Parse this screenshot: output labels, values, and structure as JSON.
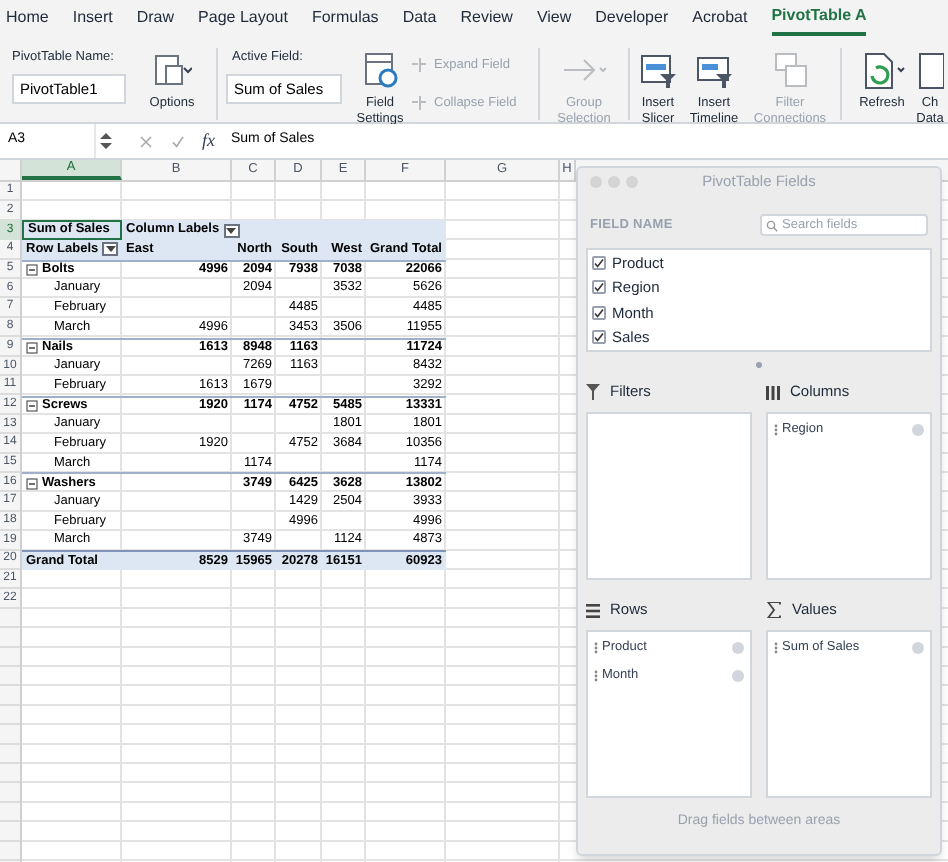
{
  "ribbon_tabs": [
    {
      "label": "Home",
      "selected": false
    },
    {
      "label": "Insert",
      "selected": false
    },
    {
      "label": "Draw",
      "selected": false
    },
    {
      "label": "Page Layout",
      "selected": false
    },
    {
      "label": "Formulas",
      "selected": false
    },
    {
      "label": "Data",
      "selected": false
    },
    {
      "label": "Review",
      "selected": false
    },
    {
      "label": "View",
      "selected": false
    },
    {
      "label": "Developer",
      "selected": false
    },
    {
      "label": "Acrobat",
      "selected": false
    },
    {
      "label": "PivotTable A",
      "selected": true
    }
  ],
  "ribbon": {
    "pivot_name": {
      "label": "PivotTable Name:",
      "value": "PivotTable1"
    },
    "options": {
      "lines": [
        "Options"
      ],
      "disabled": false
    },
    "active_field": {
      "label": "Active Field:",
      "value": "Sum of Sales"
    },
    "field_settings": {
      "lines": [
        "Field",
        "Settings"
      ],
      "disabled": false
    },
    "expand_field": {
      "label": "Expand Field",
      "disabled": true
    },
    "collapse_field": {
      "label": "Collapse Field",
      "disabled": true
    },
    "group_selection": {
      "lines": [
        "Group",
        "Selection"
      ],
      "disabled": true
    },
    "insert_slicer": {
      "lines": [
        "Insert",
        "Slicer"
      ],
      "disabled": false
    },
    "insert_timeline": {
      "lines": [
        "Insert",
        "Timeline"
      ],
      "disabled": false
    },
    "filter_connections": {
      "lines": [
        "Filter",
        "Connections"
      ],
      "disabled": true
    },
    "refresh": {
      "lines": [
        "Refresh"
      ],
      "disabled": false
    },
    "change_data": {
      "lines": [
        "Ch",
        "Data"
      ],
      "disabled": false
    }
  },
  "formula_bar": {
    "cell": "A3",
    "function_label": "fx",
    "formula": "Sum of Sales"
  },
  "columns": [
    {
      "label": "A",
      "selected": true
    },
    {
      "label": "B",
      "selected": false
    },
    {
      "label": "C",
      "selected": false
    },
    {
      "label": "D",
      "selected": false
    },
    {
      "label": "E",
      "selected": false
    },
    {
      "label": "F",
      "selected": false
    },
    {
      "label": "G",
      "selected": false
    },
    {
      "label": "H",
      "selected": false
    }
  ],
  "rows": [
    {
      "number": "1",
      "kind": "empty",
      "selected": false,
      "cells": []
    },
    {
      "number": "2",
      "kind": "empty",
      "selected": false,
      "cells": []
    },
    {
      "number": "3",
      "kind": "header",
      "selected": true,
      "cells": [
        {
          "text": "Sum of Sales"
        },
        {
          "text": "Column Labels",
          "dropdown": true
        }
      ]
    },
    {
      "number": "4",
      "kind": "header",
      "selected": false,
      "cells": [
        {
          "text": "Row Labels",
          "dropdown": true
        },
        "East",
        "North",
        "South",
        "West",
        "Grand Total"
      ]
    },
    {
      "number": "5",
      "kind": "group",
      "expanded": true,
      "selected": false,
      "cells": [
        "Bolts",
        "4996",
        "2094",
        "7938",
        "7038",
        "22066"
      ]
    },
    {
      "number": "6",
      "kind": "item",
      "selected": false,
      "cells": [
        "January",
        null,
        "2094",
        null,
        "3532",
        "5626"
      ]
    },
    {
      "number": "7",
      "kind": "item",
      "selected": false,
      "cells": [
        "February",
        null,
        null,
        "4485",
        null,
        "4485"
      ]
    },
    {
      "number": "8",
      "kind": "item",
      "selected": false,
      "cells": [
        "March",
        "4996",
        null,
        "3453",
        "3506",
        "11955"
      ]
    },
    {
      "number": "9",
      "kind": "group",
      "expanded": true,
      "selected": false,
      "cells": [
        "Nails",
        "1613",
        "8948",
        "1163",
        null,
        "11724"
      ]
    },
    {
      "number": "10",
      "kind": "item",
      "selected": false,
      "cells": [
        "January",
        null,
        "7269",
        "1163",
        null,
        "8432"
      ]
    },
    {
      "number": "11",
      "kind": "item",
      "selected": false,
      "cells": [
        "February",
        "1613",
        "1679",
        null,
        null,
        "3292"
      ]
    },
    {
      "number": "12",
      "kind": "group",
      "expanded": true,
      "selected": false,
      "cells": [
        "Screws",
        "1920",
        "1174",
        "4752",
        "5485",
        "13331"
      ]
    },
    {
      "number": "13",
      "kind": "item",
      "selected": false,
      "cells": [
        "January",
        null,
        null,
        null,
        "1801",
        "1801"
      ]
    },
    {
      "number": "14",
      "kind": "item",
      "selected": false,
      "cells": [
        "February",
        "1920",
        null,
        "4752",
        "3684",
        "10356"
      ]
    },
    {
      "number": "15",
      "kind": "item",
      "selected": false,
      "cells": [
        "March",
        null,
        "1174",
        null,
        null,
        "1174"
      ]
    },
    {
      "number": "16",
      "kind": "group",
      "expanded": true,
      "selected": false,
      "cells": [
        "Washers",
        null,
        "3749",
        "6425",
        "3628",
        "13802"
      ]
    },
    {
      "number": "17",
      "kind": "item",
      "selected": false,
      "cells": [
        "January",
        null,
        null,
        "1429",
        "2504",
        "3933"
      ]
    },
    {
      "number": "18",
      "kind": "item",
      "selected": false,
      "cells": [
        "February",
        null,
        null,
        "4996",
        null,
        "4996"
      ]
    },
    {
      "number": "19",
      "kind": "item",
      "selected": false,
      "cells": [
        "March",
        null,
        "3749",
        null,
        "1124",
        "4873"
      ]
    },
    {
      "number": "20",
      "kind": "total",
      "selected": false,
      "cells": [
        "Grand Total",
        "8529",
        "15965",
        "20278",
        "16151",
        "60923"
      ]
    },
    {
      "number": "21",
      "kind": "empty",
      "selected": false,
      "cells": []
    },
    {
      "number": "22",
      "kind": "empty",
      "selected": false,
      "cells": []
    }
  ],
  "pivot_panel": {
    "title": "PivotTable Fields",
    "field_name": "FIELD NAME",
    "search": {
      "placeholder": "Search fields"
    },
    "fields": [
      {
        "label": "Product",
        "checked": true
      },
      {
        "label": "Region",
        "checked": true
      },
      {
        "label": "Month",
        "checked": true
      },
      {
        "label": "Sales",
        "checked": true
      }
    ],
    "filters": {
      "title": "Filters"
    },
    "columns": {
      "title": "Columns",
      "items": [
        "Region"
      ]
    },
    "rows": {
      "title": "Rows",
      "items": [
        "Product",
        "Month"
      ]
    },
    "values": {
      "title": "Values",
      "items": [
        "Sum of Sales"
      ]
    },
    "footer": "Drag fields between areas"
  }
}
